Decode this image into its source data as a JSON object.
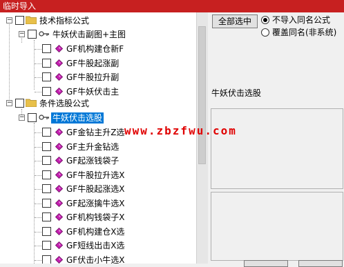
{
  "window": {
    "title": "临时导入"
  },
  "tree": {
    "group1": {
      "label": "技术指标公式",
      "sub": {
        "label": "牛妖伏击副图+主图",
        "items": [
          "GF机构建仓新F",
          "GF牛股起涨副",
          "GF牛股拉升副",
          "GF牛妖伏击主"
        ]
      }
    },
    "group2": {
      "label": "条件选股公式",
      "sub": {
        "label": "牛妖伏击选股",
        "items": [
          "GF金钻主升Z选",
          "GF主升金钻选",
          "GF起涨钱袋子",
          "GF牛股拉升选X",
          "GF牛股起涨选X",
          "GF起涨擒牛选X",
          "GF机构钱袋子X",
          "GF机构建仓X选",
          "GF短线出击X选",
          "GF伏击小牛选X"
        ]
      }
    }
  },
  "controls": {
    "select_all": "全部选中",
    "option_skip": "不导入同名公式",
    "option_overwrite": "覆盖同名(非系统)"
  },
  "detail": {
    "name": "牛妖伏击选股"
  },
  "watermark": "www.zbzfwu.com",
  "colors": {
    "title_bar": "#c72020",
    "selection": "#0078d7",
    "gem": "#c41fb0",
    "folder": "#e8c04a"
  }
}
